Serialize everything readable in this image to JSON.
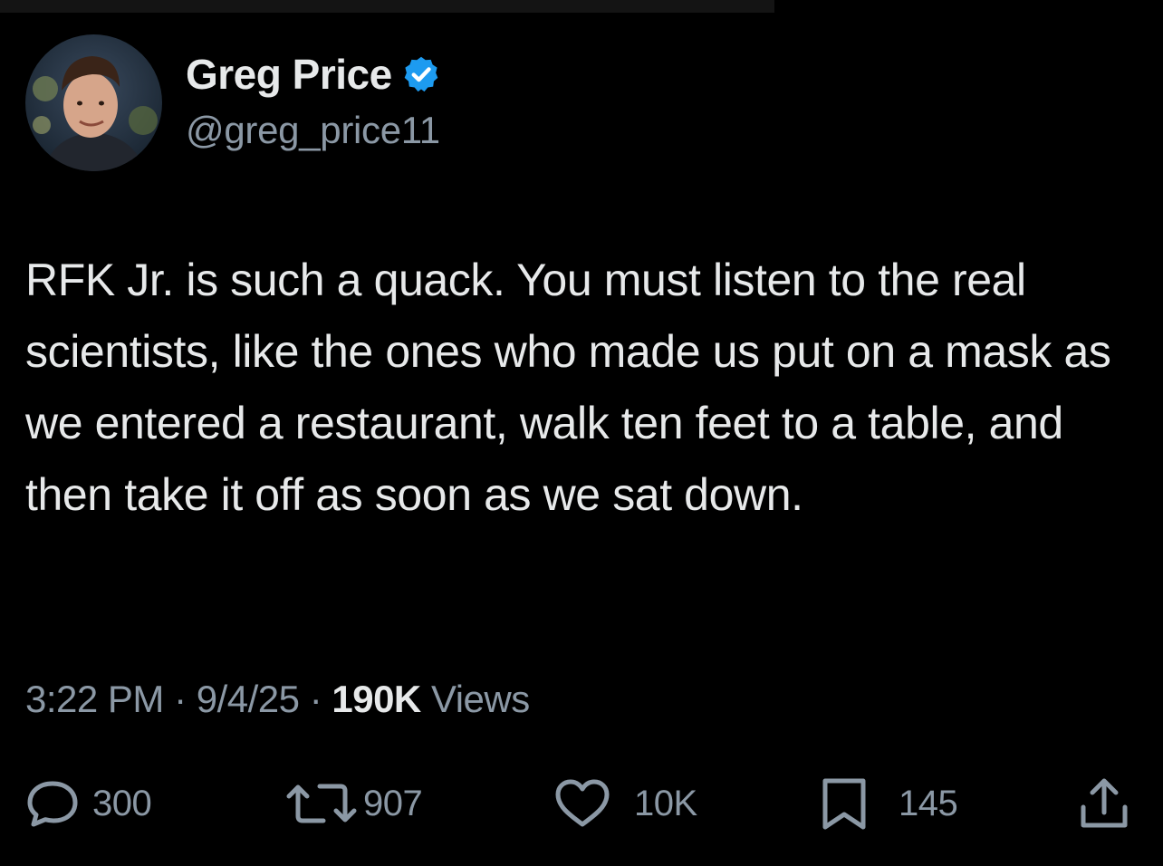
{
  "author": {
    "display_name": "Greg Price",
    "handle": "@greg_price11",
    "verified_color": "#1d9bf0"
  },
  "tweet": {
    "text": "RFK Jr. is such a quack. You must listen to the real scientists, like the ones who made us put on a mask as we entered a restaurant, walk ten feet to a table, and then take it off as soon as we sat down."
  },
  "meta": {
    "time": "3:22 PM",
    "separator": "·",
    "date": "9/4/25",
    "views_count": "190K",
    "views_label": "Views"
  },
  "actions": {
    "replies": {
      "icon": "reply-icon",
      "count": "300"
    },
    "reposts": {
      "icon": "repost-icon",
      "count": "907"
    },
    "likes": {
      "icon": "like-icon",
      "count": "10K"
    },
    "bookmarks": {
      "icon": "bookmark-icon",
      "count": "145"
    },
    "share": {
      "icon": "share-icon"
    }
  },
  "colors": {
    "background": "#000000",
    "primary_text": "#e7e9ea",
    "secondary_text": "#8b98a5",
    "accent": "#1d9bf0"
  }
}
